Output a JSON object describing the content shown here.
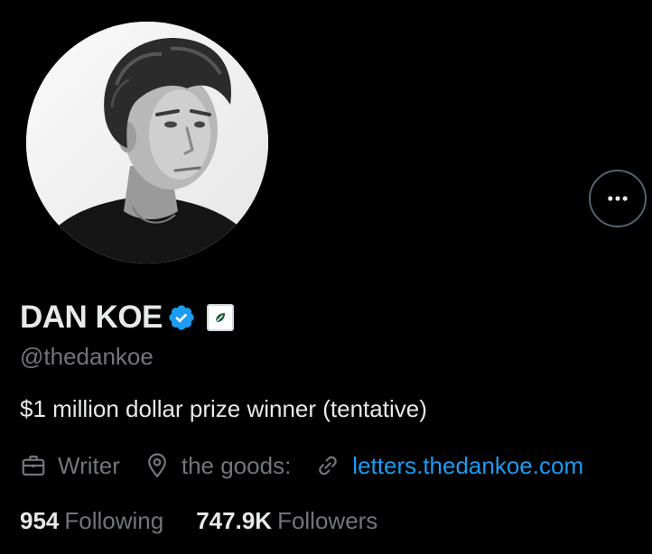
{
  "profile": {
    "display_name": "DAN KOE",
    "handle": "@thedankoe",
    "bio": "$1 million dollar prize winner (tentative)",
    "verified": true,
    "verified_color": "#1d9bf0",
    "avatar": "profile-photo"
  },
  "meta": {
    "profession": "Writer",
    "location": "the goods:",
    "website": "letters.thedankoe.com",
    "profession_icon": "briefcase-icon",
    "location_icon": "map-pin-icon",
    "website_icon": "link-icon"
  },
  "stats": {
    "following_count": "954",
    "following_label": "Following",
    "followers_count": "747.9K",
    "followers_label": "Followers"
  },
  "actions": {
    "more_icon": "more-horizontal-icon"
  },
  "colors": {
    "background": "#000000",
    "primary_text": "#e7e9ea",
    "secondary_text": "#71767b",
    "link": "#1d9bf0"
  }
}
